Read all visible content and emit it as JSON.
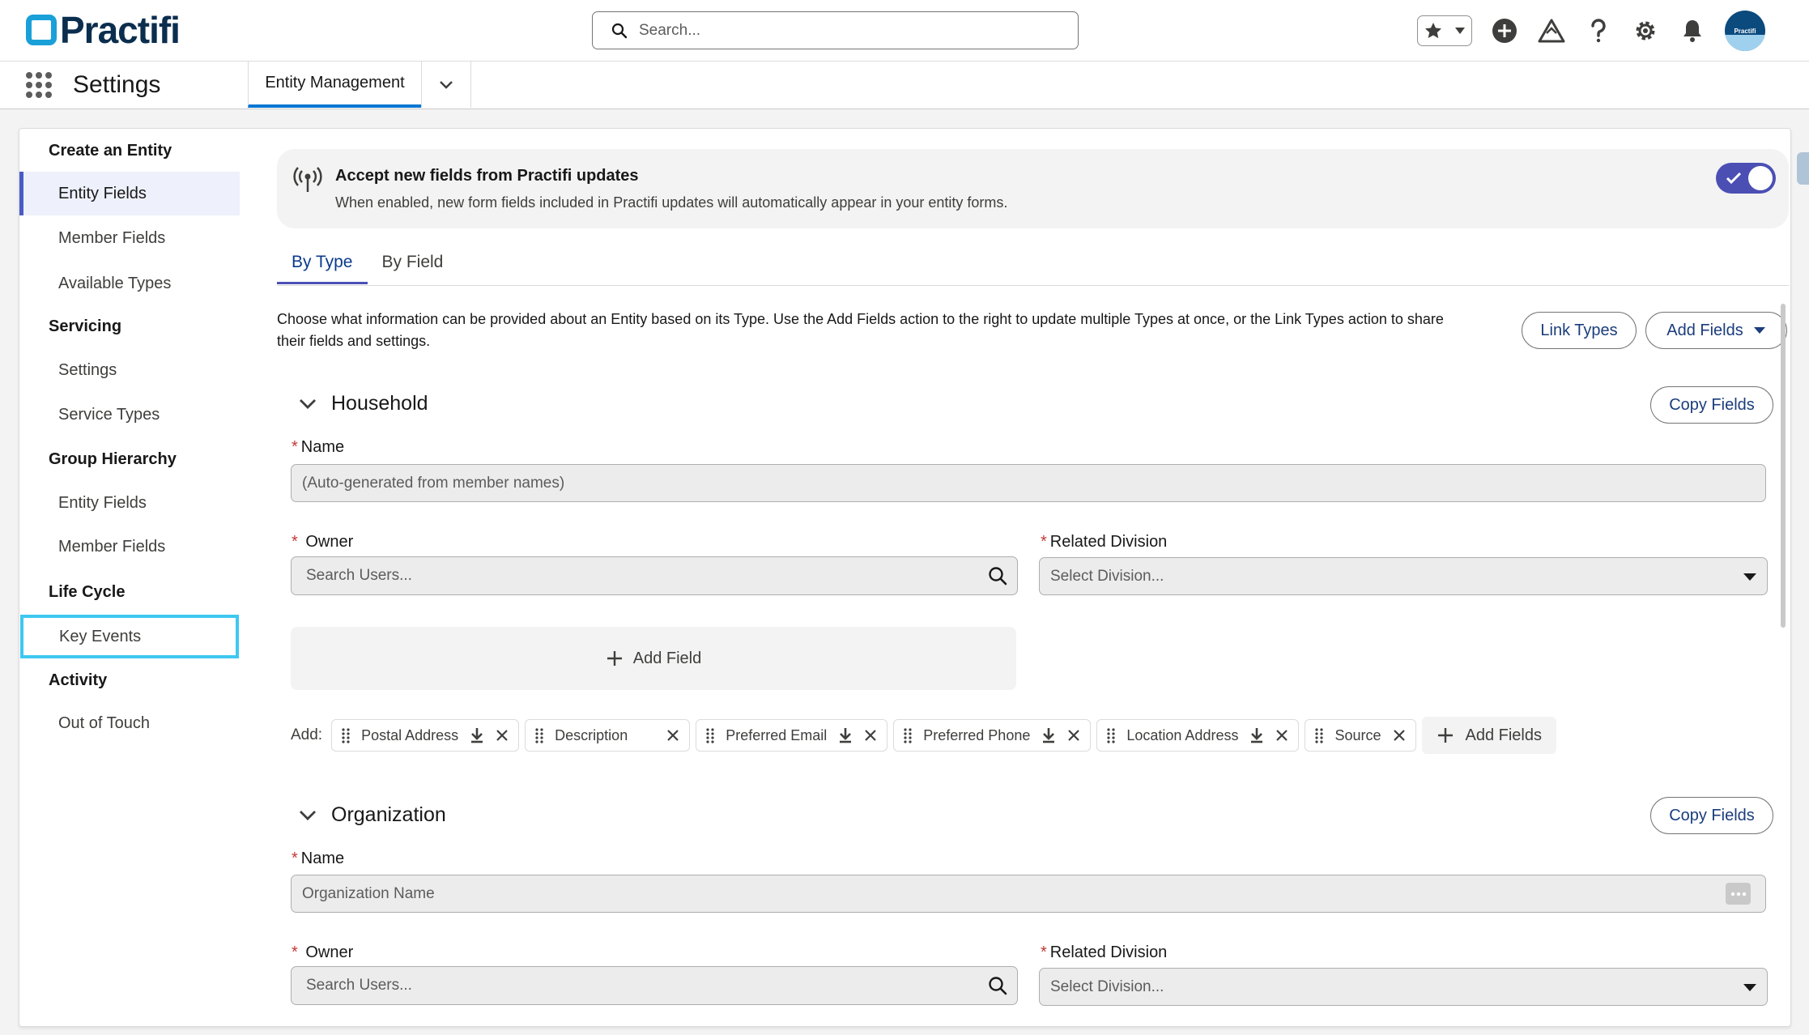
{
  "header": {
    "logo_text": "Practifi",
    "search_placeholder": "Search...",
    "avatar_text": "Practifi"
  },
  "subnav": {
    "app_name": "Settings",
    "tab_label": "Entity Management"
  },
  "sidebar": {
    "sections": [
      {
        "title": "Create an Entity",
        "items": [
          "Entity Fields",
          "Member Fields",
          "Available Types"
        ]
      },
      {
        "title": "Servicing",
        "items": [
          "Settings",
          "Service Types"
        ]
      },
      {
        "title": "Group Hierarchy",
        "items": [
          "Entity Fields",
          "Member Fields"
        ]
      },
      {
        "title": "Life Cycle",
        "items": [
          "Key Events"
        ]
      },
      {
        "title": "Activity",
        "items": [
          "Out of Touch"
        ]
      }
    ]
  },
  "banner": {
    "title": "Accept new fields from Practifi updates",
    "subtitle": "When enabled, new form fields included in Practifi updates will automatically appear in your entity forms.",
    "toggle_on": true
  },
  "tabs": [
    "By Type",
    "By Field"
  ],
  "description": "Choose what information can be provided about an Entity based on its Type. Use the Add Fields action to the right to update multiple Types at once, or the Link Types action to share their fields and settings.",
  "actions": {
    "link_types": "Link Types",
    "add_fields": "Add Fields",
    "copy_fields": "Copy Fields"
  },
  "household": {
    "title": "Household",
    "name_label": "Name",
    "name_placeholder": "(Auto-generated from member names)",
    "owner_label": "Owner",
    "owner_placeholder": "Search Users...",
    "division_label": "Related Division",
    "division_placeholder": "Select Division...",
    "add_field": "Add Field",
    "add_label": "Add:",
    "chips": [
      {
        "label": "Postal Address",
        "download": true
      },
      {
        "label": "Description",
        "download": false
      },
      {
        "label": "Preferred Email",
        "download": true
      },
      {
        "label": "Preferred Phone",
        "download": true
      },
      {
        "label": "Location Address",
        "download": true
      },
      {
        "label": "Source",
        "download": false
      }
    ],
    "add_fields_chip": "Add Fields"
  },
  "organization": {
    "title": "Organization",
    "name_label": "Name",
    "name_placeholder": "Organization Name",
    "owner_label": "Owner",
    "owner_placeholder": "Search Users...",
    "division_label": "Related Division",
    "division_placeholder": "Select Division..."
  },
  "colors": {
    "accent": "#4b4fb4",
    "required": "#c23934",
    "focus_outline": "#3ec8f0",
    "logo_blue": "#1aa0d8"
  }
}
